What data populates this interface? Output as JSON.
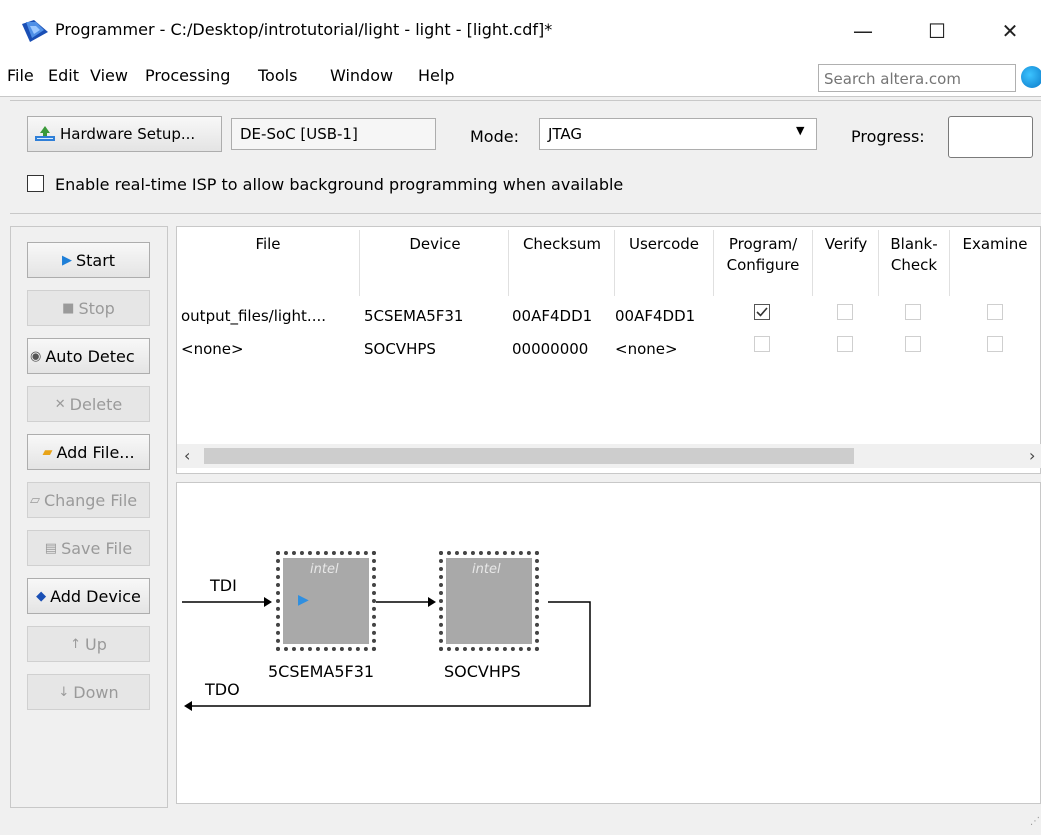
{
  "window": {
    "title": "Programmer - C:/Desktop/introtutorial/light - light - [light.cdf]*",
    "minimize": "—",
    "maximize": "☐",
    "close": "✕"
  },
  "menu": {
    "items": [
      "File",
      "Edit",
      "View",
      "Processing",
      "Tools",
      "Window",
      "Help"
    ],
    "search_placeholder": "Search altera.com"
  },
  "toolbar": {
    "hardware_setup_label": "Hardware Setup...",
    "hardware": "DE-SoC [USB-1]",
    "mode_label": "Mode:",
    "mode_value": "JTAG",
    "progress_label": "Progress:",
    "isp_label": "Enable real-time ISP to allow background programming when available",
    "isp_checked": false
  },
  "side_buttons": [
    {
      "label": "Start",
      "enabled": true,
      "icon": "start-icon"
    },
    {
      "label": "Stop",
      "enabled": false,
      "icon": "stop-icon"
    },
    {
      "label": "Auto Detec",
      "enabled": true,
      "icon": "auto-detect-icon"
    },
    {
      "label": "Delete",
      "enabled": false,
      "icon": "delete-icon"
    },
    {
      "label": "Add File...",
      "enabled": true,
      "icon": "add-file-icon"
    },
    {
      "label": "Change File",
      "enabled": false,
      "icon": "change-file-icon"
    },
    {
      "label": "Save File",
      "enabled": false,
      "icon": "save-file-icon"
    },
    {
      "label": "Add Device",
      "enabled": true,
      "icon": "add-device-icon"
    },
    {
      "label": "Up",
      "enabled": false,
      "icon": "up-icon"
    },
    {
      "label": "Down",
      "enabled": false,
      "icon": "down-icon"
    }
  ],
  "table": {
    "headers": [
      "File",
      "Device",
      "Checksum",
      "Usercode",
      "Program/\nConfigure",
      "Verify",
      "Blank-\nCheck",
      "Examine"
    ],
    "rows": [
      {
        "file": "output_files/light....",
        "device": "5CSEMA5F31",
        "checksum": "00AF4DD1",
        "usercode": "00AF4DD1",
        "program": true,
        "verify": false,
        "blank": false,
        "examine": false
      },
      {
        "file": "<none>",
        "device": "SOCVHPS",
        "checksum": "00000000",
        "usercode": "<none>",
        "program": false,
        "verify": false,
        "blank": false,
        "examine": false
      }
    ]
  },
  "chain": {
    "tdi": "TDI",
    "tdo": "TDO",
    "devices": [
      "5CSEMA5F31",
      "SOCVHPS"
    ],
    "logo": "intel"
  }
}
